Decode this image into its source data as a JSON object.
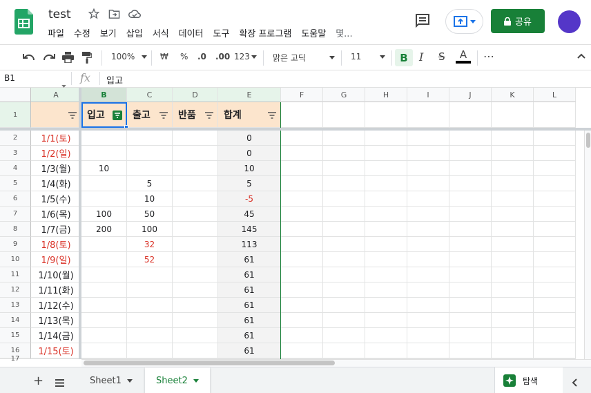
{
  "header": {
    "title": "test",
    "menu": [
      "파일",
      "수정",
      "보기",
      "삽입",
      "서식",
      "데이터",
      "도구",
      "확장 프로그램",
      "도움말",
      "몇..."
    ],
    "share_label": "공유"
  },
  "toolbar": {
    "zoom": "100%",
    "currency": "₩",
    "percent": "%",
    "dec_less": ".0",
    "dec_more": ".00",
    "format": "123",
    "font": "맑은 고딕",
    "font_size": "11",
    "bold": "B",
    "italic": "I",
    "strike": "S",
    "text_color": "A",
    "more": "⋯"
  },
  "formula_bar": {
    "cell_ref": "B1",
    "fx": "fx",
    "value": "입고"
  },
  "columns": [
    "A",
    "B",
    "C",
    "D",
    "E",
    "F",
    "G",
    "H",
    "I",
    "J",
    "K",
    "L"
  ],
  "header_row": {
    "b": "입고",
    "c": "출고",
    "d": "반품",
    "e": "합계"
  },
  "rows": [
    {
      "num": "2",
      "date": "1/1(토)",
      "in": "",
      "out": "",
      "total": "0",
      "date_red": true
    },
    {
      "num": "3",
      "date": "1/2(일)",
      "in": "",
      "out": "",
      "total": "0",
      "date_red": true
    },
    {
      "num": "4",
      "date": "1/3(월)",
      "in": "10",
      "out": "",
      "total": "10"
    },
    {
      "num": "5",
      "date": "1/4(화)",
      "in": "",
      "out": "5",
      "total": "5"
    },
    {
      "num": "6",
      "date": "1/5(수)",
      "in": "",
      "out": "10",
      "total": "-5",
      "total_red": true
    },
    {
      "num": "7",
      "date": "1/6(목)",
      "in": "100",
      "out": "50",
      "total": "45"
    },
    {
      "num": "8",
      "date": "1/7(금)",
      "in": "200",
      "out": "100",
      "total": "145"
    },
    {
      "num": "9",
      "date": "1/8(토)",
      "in": "",
      "out": "32",
      "total": "113",
      "date_red": true,
      "out_red": true
    },
    {
      "num": "10",
      "date": "1/9(일)",
      "in": "",
      "out": "52",
      "total": "61",
      "date_red": true,
      "out_red": true
    },
    {
      "num": "11",
      "date": "1/10(월)",
      "in": "",
      "out": "",
      "total": "61"
    },
    {
      "num": "12",
      "date": "1/11(화)",
      "in": "",
      "out": "",
      "total": "61"
    },
    {
      "num": "13",
      "date": "1/12(수)",
      "in": "",
      "out": "",
      "total": "61"
    },
    {
      "num": "14",
      "date": "1/13(목)",
      "in": "",
      "out": "",
      "total": "61"
    },
    {
      "num": "15",
      "date": "1/14(금)",
      "in": "",
      "out": "",
      "total": "61"
    },
    {
      "num": "16",
      "date": "1/15(토)",
      "in": "",
      "out": "",
      "total": "61",
      "date_red": true
    },
    {
      "num": "17",
      "date": "",
      "in": "",
      "out": "",
      "total": ""
    }
  ],
  "sheets": {
    "sheet1": "Sheet1",
    "sheet2": "Sheet2",
    "explore": "탐색"
  },
  "colors": {
    "green": "#188038",
    "header_fill": "#fce5cd",
    "red": "#d93025",
    "avatar": "#5436c8"
  }
}
